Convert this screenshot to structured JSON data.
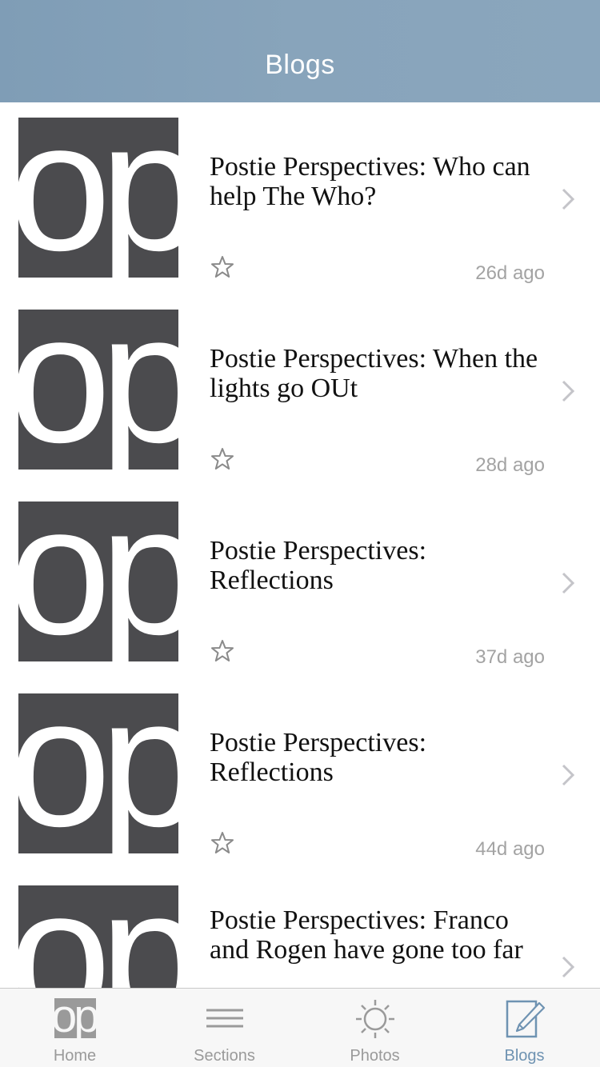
{
  "navbar": {
    "title": "Blogs"
  },
  "colors": {
    "navbar": "#86a2b9",
    "thumb": "#4b4b4e",
    "accent": "#6f93b2",
    "inactive": "#9a9a9a"
  },
  "thumbnail": {
    "logo_text": "op"
  },
  "posts": [
    {
      "title": "Postie Perspectives: Who can help The Who?",
      "time": "26d ago",
      "favorite_icon": "star-outline-icon",
      "chevron_icon": "chevron-right-icon"
    },
    {
      "title": "Postie Perspectives: When the lights go OUt",
      "time": "28d ago",
      "favorite_icon": "star-outline-icon",
      "chevron_icon": "chevron-right-icon"
    },
    {
      "title": "Postie Perspectives: Reflections",
      "time": "37d ago",
      "favorite_icon": "star-outline-icon",
      "chevron_icon": "chevron-right-icon"
    },
    {
      "title": "Postie Perspectives: Reflections",
      "time": "44d ago",
      "favorite_icon": "star-outline-icon",
      "chevron_icon": "chevron-right-icon"
    },
    {
      "title": "Postie Perspectives: Franco and Rogen have gone too far",
      "time": "",
      "favorite_icon": "star-outline-icon",
      "chevron_icon": "chevron-right-icon"
    }
  ],
  "tabbar": {
    "items": [
      {
        "label": "Home",
        "icon": "op-logo-icon",
        "active": false
      },
      {
        "label": "Sections",
        "icon": "menu-lines-icon",
        "active": false
      },
      {
        "label": "Photos",
        "icon": "sun-icon",
        "active": false
      },
      {
        "label": "Blogs",
        "icon": "pencil-page-icon",
        "active": true
      }
    ]
  }
}
